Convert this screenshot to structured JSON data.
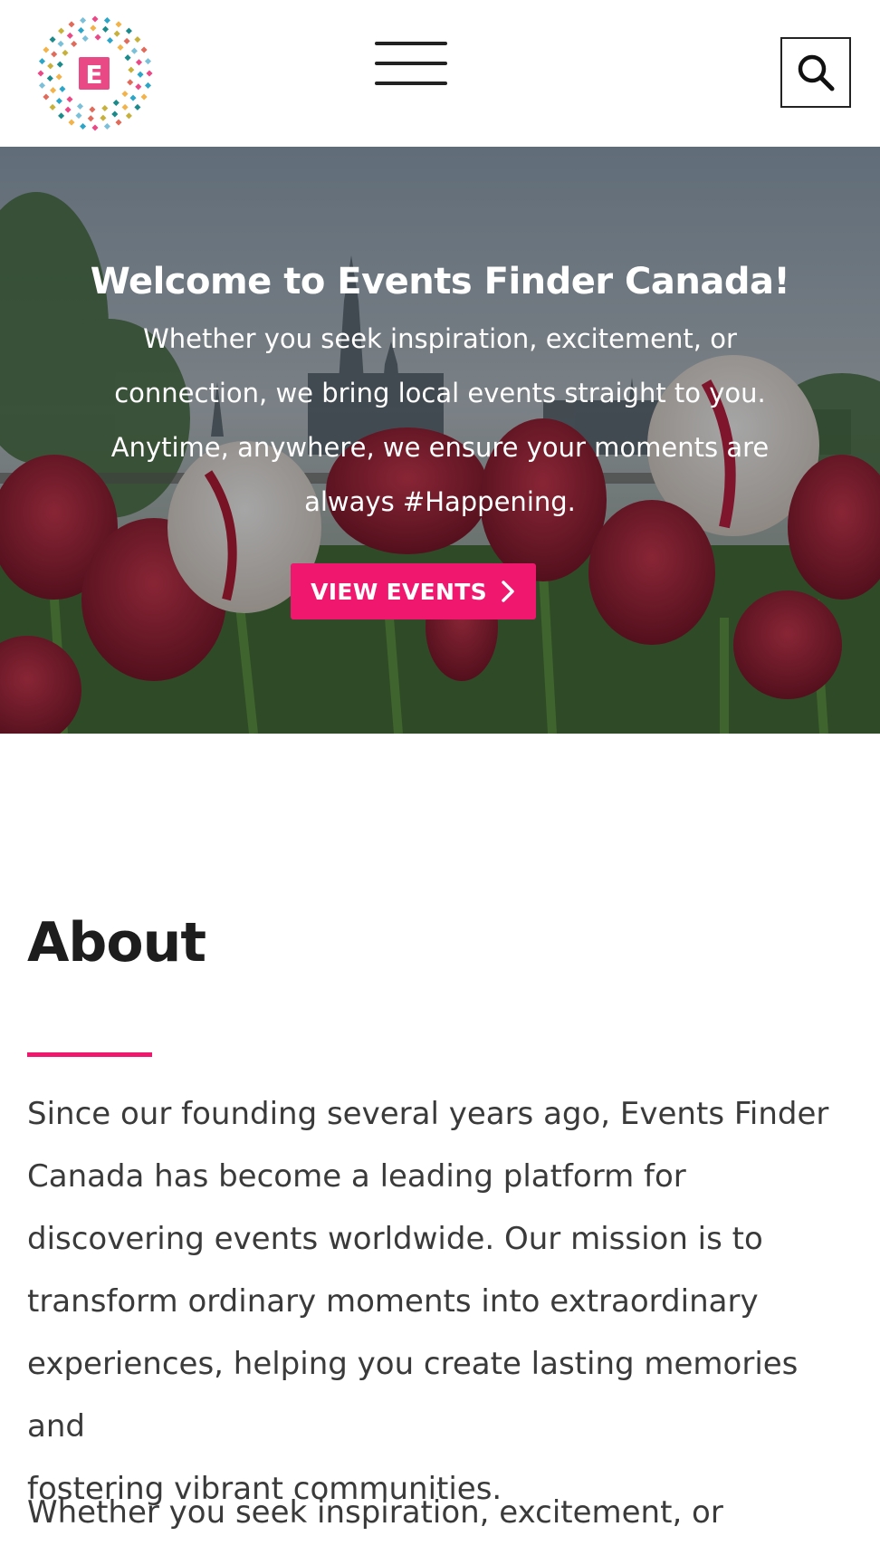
{
  "brand": {
    "logo_letter": "E",
    "accent_color": "#f0176e"
  },
  "header": {
    "menu_icon": "hamburger-menu-icon",
    "search_icon": "search-icon"
  },
  "hero": {
    "title": "Welcome to Events Finder Canada!",
    "lines": [
      "Whether you seek inspiration, excitement, or",
      "connection, we bring local events straight to you.",
      "Anytime, anywhere, we ensure your moments are",
      "always #Happening."
    ],
    "cta_label": "VIEW EVENTS"
  },
  "about": {
    "title": "About",
    "paragraph1_lines": [
      "Since our founding several years ago, Events Finder",
      "Canada has become a leading platform for",
      "discovering events worldwide. Our mission is to",
      "transform ordinary moments into extraordinary",
      "experiences, helping you create lasting memories and",
      "fostering vibrant communities."
    ],
    "paragraph2_first_line": "Whether you seek inspiration, excitement, or"
  }
}
